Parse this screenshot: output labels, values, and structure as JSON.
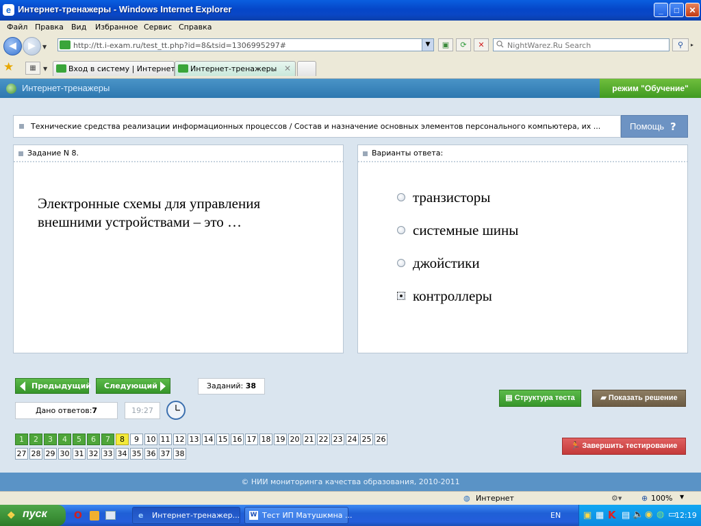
{
  "window": {
    "title": "Интернет-тренажеры - Windows Internet Explorer",
    "controls": {
      "minimize": "_",
      "maximize": "□",
      "close": "✕"
    }
  },
  "menu": [
    "Файл",
    "Правка",
    "Вид",
    "Избранное",
    "Сервис",
    "Справка"
  ],
  "address": {
    "url": "http://tt.i-exam.ru/test_tt.php?id=8&tsid=1306995297#",
    "search_placeholder": "NightWarez.Ru Search"
  },
  "tabs": [
    {
      "label": "Вход в систему | Интернет-...",
      "active": false
    },
    {
      "label": "Интернет-тренажеры",
      "active": true
    }
  ],
  "app": {
    "title": "Интернет-тренажеры",
    "mode": "режим \"Обучение\""
  },
  "breadcrumb": "Технические средства реализации информационных процессов / Состав и назначение основных элементов персонального компьютера, их ...",
  "help": {
    "label": "Помощь",
    "icon": "?"
  },
  "task": {
    "header": "Задание N 8.",
    "text": "Электронные схемы для управления внешними устройствами – это …"
  },
  "answers": {
    "header": "Варианты ответа:",
    "options": [
      {
        "text": "транзисторы",
        "selected": false
      },
      {
        "text": "системные шины",
        "selected": false
      },
      {
        "text": "джойстики",
        "selected": false
      },
      {
        "text": "контроллеры",
        "selected": true
      }
    ]
  },
  "controls": {
    "prev": "Предыдущий",
    "next": "Следующий",
    "tasks_label": "Заданий:",
    "tasks_count": "38",
    "answered_label": "Дано ответов:",
    "answered_count": "7",
    "timer": "19:27",
    "structure": "Структура теста",
    "show_solution": "Показать решение",
    "finish": "Завершить тестирование"
  },
  "question_numbers": {
    "total": 38,
    "answered": [
      1,
      2,
      3,
      4,
      5,
      6,
      7
    ],
    "current": 8
  },
  "footer": "© НИИ мониторинга качества образования, 2010-2011",
  "statusbar": {
    "zone": "Интернет",
    "zoom": "100%"
  },
  "taskbar": {
    "start": "пуск",
    "buttons": [
      "Интернет-тренажер...",
      "Тест ИП Матушкмна ..."
    ],
    "lang": "EN",
    "clock": "12:19"
  },
  "colors": {
    "accent_blue": "#2e78b0",
    "done_green": "#4ea53a",
    "current_yellow": "#f3ea3a",
    "finish_red": "#d04848",
    "solution_brown": "#7a6a52"
  }
}
